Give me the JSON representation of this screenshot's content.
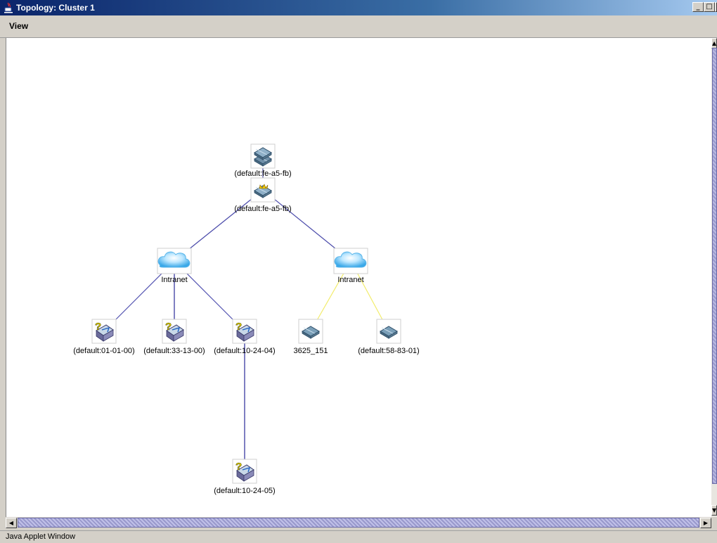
{
  "window": {
    "title": "Topology: Cluster 1"
  },
  "menu": {
    "view_label": "View"
  },
  "topology": {
    "nodes": [
      {
        "id": "stack",
        "type": "switch-stack",
        "label": "(default:fe-a5-fb)"
      },
      {
        "id": "master",
        "type": "master-switch",
        "label": "(default:fe-a5-fb)"
      },
      {
        "id": "intranet-1",
        "type": "cloud",
        "label": "Intranet"
      },
      {
        "id": "intranet-2",
        "type": "cloud",
        "label": "Intranet"
      },
      {
        "id": "dev-1",
        "type": "unknown-switch",
        "label": "(default:01-01-00)"
      },
      {
        "id": "dev-2",
        "type": "unknown-switch",
        "label": "(default:33-13-00)"
      },
      {
        "id": "dev-3",
        "type": "unknown-switch",
        "label": "(default:10-24-04)"
      },
      {
        "id": "dev-4",
        "type": "switch",
        "label": "3625_151"
      },
      {
        "id": "dev-5",
        "type": "switch",
        "label": "(default:58-83-01)"
      },
      {
        "id": "dev-6",
        "type": "unknown-switch",
        "label": "(default:10-24-05)"
      }
    ],
    "links": [
      {
        "from": "stack",
        "to": "master",
        "color": "#4a4a9a"
      },
      {
        "from": "master",
        "to": "intranet-1",
        "color": "#4a4aaa"
      },
      {
        "from": "master",
        "to": "intranet-2",
        "color": "#4a4aaa"
      },
      {
        "from": "intranet-1",
        "to": "dev-1",
        "color": "#5050b0"
      },
      {
        "from": "intranet-1",
        "to": "dev-2",
        "color": "#2a2a9a"
      },
      {
        "from": "intranet-1",
        "to": "dev-3",
        "color": "#5050b0"
      },
      {
        "from": "intranet-2",
        "to": "dev-4",
        "color": "#f2ec6a"
      },
      {
        "from": "intranet-2",
        "to": "dev-5",
        "color": "#f2ec6a"
      },
      {
        "from": "dev-3",
        "to": "dev-6",
        "color": "#2a2a9a"
      }
    ]
  },
  "status": {
    "text": "Java Applet Window"
  }
}
